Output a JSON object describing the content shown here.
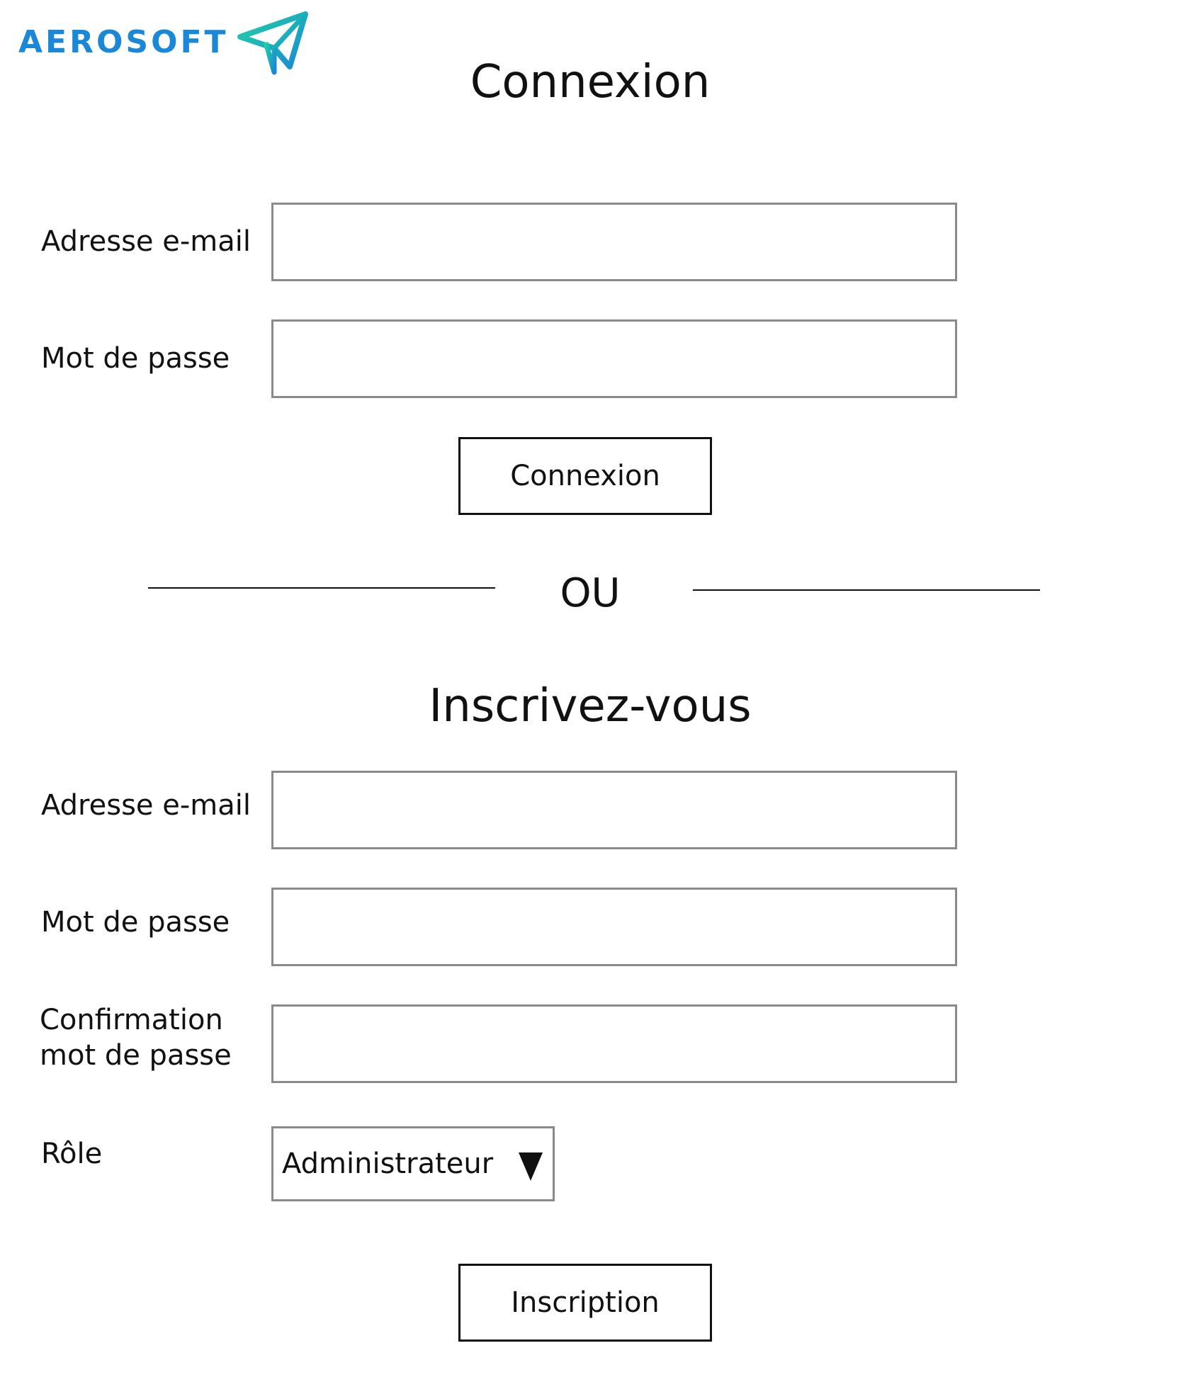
{
  "brand": {
    "name": "AEROSOFT",
    "color": "#1a88d6",
    "icon": "paper-plane-icon"
  },
  "login": {
    "title": "Connexion",
    "email_label": "Adresse e-mail",
    "email_value": "",
    "password_label": "Mot de passe",
    "password_value": "",
    "submit_label": "Connexion"
  },
  "separator": {
    "label": "OU"
  },
  "signup": {
    "title": "Inscrivez-vous",
    "email_label": "Adresse e-mail",
    "email_value": "",
    "password_label": "Mot de passe",
    "password_value": "",
    "confirm_label_line1": "Confirmation",
    "confirm_label_line2": "mot de passe",
    "confirm_value": "",
    "role_label": "Rôle",
    "role_value": "Administrateur",
    "role_dropdown_icon": "triangle-down-icon",
    "submit_label": "Inscription"
  },
  "colors": {
    "field_border": "#8a8a8a",
    "button_border": "#111111",
    "text": "#111111"
  }
}
